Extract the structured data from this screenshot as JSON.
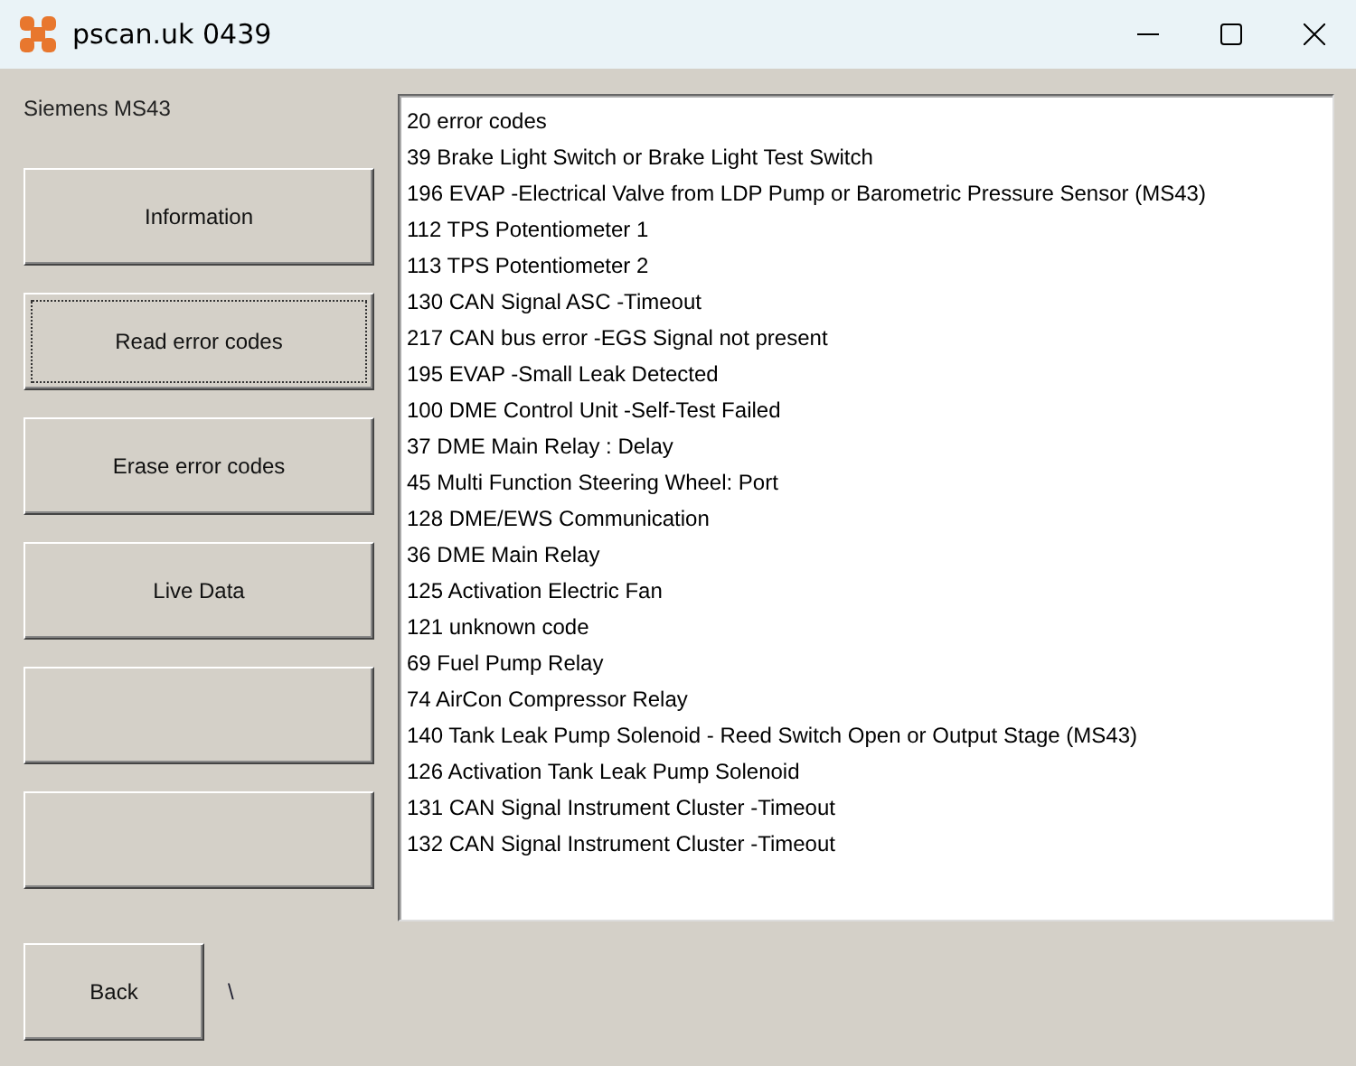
{
  "window": {
    "title": "pscan.uk 0439"
  },
  "ecu_label": "Siemens MS43",
  "buttons": [
    {
      "label": "Information",
      "focused": false
    },
    {
      "label": "Read error codes",
      "focused": true
    },
    {
      "label": "Erase error codes",
      "focused": false
    },
    {
      "label": "Live Data",
      "focused": false
    },
    {
      "focused": false
    },
    {
      "focused": false
    }
  ],
  "back_button": {
    "label": "Back"
  },
  "status_text": "\\",
  "output_lines": [
    "20 error codes",
    "39 Brake Light Switch or Brake Light Test Switch",
    "196 EVAP -Electrical Valve from LDP Pump or Barometric Pressure Sensor (MS43)",
    "112 TPS Potentiometer 1",
    "113 TPS Potentiometer 2",
    "130 CAN Signal ASC -Timeout",
    "217 CAN bus error -EGS Signal not present",
    "195 EVAP -Small Leak Detected",
    "100 DME Control Unit -Self-Test Failed",
    "37 DME Main Relay : Delay",
    "45 Multi Function Steering Wheel: Port",
    "128 DME/EWS Communication",
    "36 DME Main Relay",
    "125 Activation Electric Fan",
    "121 unknown code",
    "69 Fuel Pump Relay",
    "74 AirCon Compressor Relay",
    "140 Tank Leak Pump Solenoid - Reed Switch Open or Output Stage (MS43)",
    "126 Activation Tank Leak Pump Solenoid",
    "131 CAN Signal Instrument Cluster -Timeout",
    "132 CAN Signal Instrument Cluster -Timeout"
  ]
}
